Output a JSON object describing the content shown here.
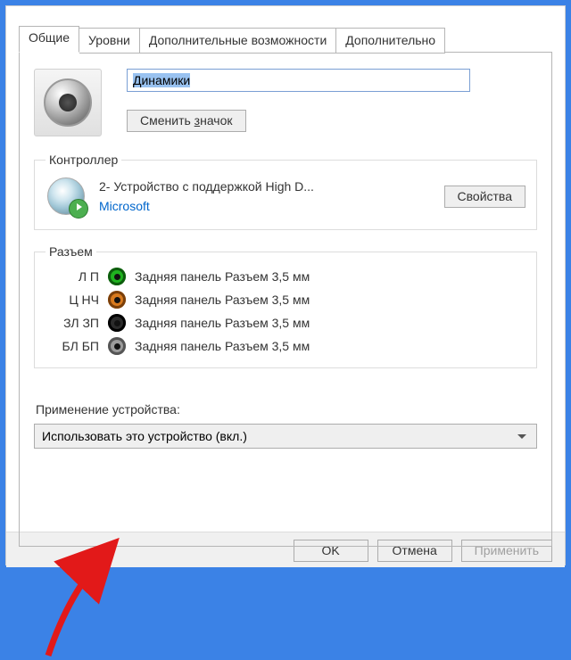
{
  "tabs": {
    "general": "Общие",
    "levels": "Уровни",
    "enhancements": "Дополнительные возможности",
    "advanced": "Дополнительно"
  },
  "device": {
    "name": "Динамики",
    "change_icon_prefix": "Сменить ",
    "change_icon_u": "з",
    "change_icon_suffix": "начок"
  },
  "controller": {
    "legend": "Контроллер",
    "name": "2- Устройство с поддержкой High D...",
    "vendor": "Microsoft",
    "properties_btn": "Свойства"
  },
  "jacks": {
    "legend": "Разъем",
    "label": "Задняя панель Разъем 3,5 мм",
    "items": [
      {
        "abbr": "Л П",
        "color": "#1fb31f",
        "ring": "#0d5c0d"
      },
      {
        "abbr": "Ц НЧ",
        "color": "#d87a1e",
        "ring": "#7a3f0a"
      },
      {
        "abbr": "ЗЛ ЗП",
        "color": "#2b2b2b",
        "ring": "#000"
      },
      {
        "abbr": "БЛ БП",
        "color": "#9b9b9b",
        "ring": "#555"
      }
    ]
  },
  "usage": {
    "label": "Применение устройства:",
    "value": "Использовать это устройство (вкл.)"
  },
  "buttons": {
    "ok": "OK",
    "cancel": "Отмена",
    "apply": "Применить"
  },
  "colors": {
    "accent": "#3b82e6",
    "link": "#0066cc"
  }
}
